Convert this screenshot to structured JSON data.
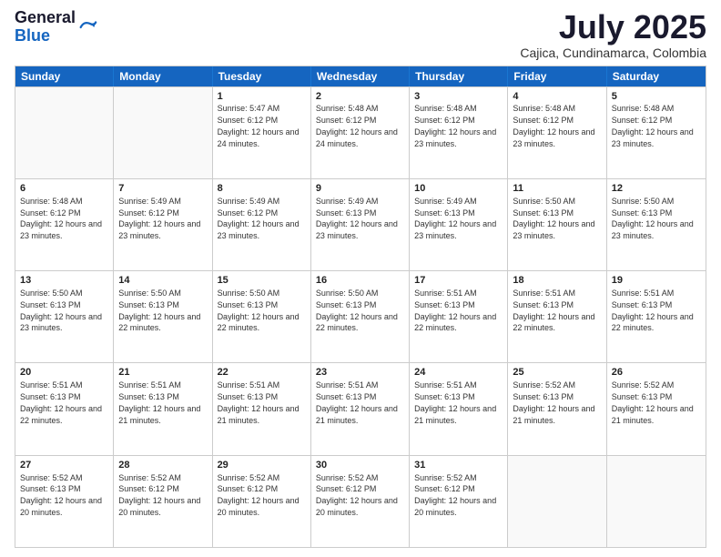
{
  "logo": {
    "general": "General",
    "blue": "Blue"
  },
  "header": {
    "month": "July 2025",
    "location": "Cajica, Cundinamarca, Colombia"
  },
  "days": [
    "Sunday",
    "Monday",
    "Tuesday",
    "Wednesday",
    "Thursday",
    "Friday",
    "Saturday"
  ],
  "weeks": [
    [
      {
        "day": "",
        "sunrise": "",
        "sunset": "",
        "daylight": ""
      },
      {
        "day": "",
        "sunrise": "",
        "sunset": "",
        "daylight": ""
      },
      {
        "day": "1",
        "sunrise": "Sunrise: 5:47 AM",
        "sunset": "Sunset: 6:12 PM",
        "daylight": "Daylight: 12 hours and 24 minutes."
      },
      {
        "day": "2",
        "sunrise": "Sunrise: 5:48 AM",
        "sunset": "Sunset: 6:12 PM",
        "daylight": "Daylight: 12 hours and 24 minutes."
      },
      {
        "day": "3",
        "sunrise": "Sunrise: 5:48 AM",
        "sunset": "Sunset: 6:12 PM",
        "daylight": "Daylight: 12 hours and 23 minutes."
      },
      {
        "day": "4",
        "sunrise": "Sunrise: 5:48 AM",
        "sunset": "Sunset: 6:12 PM",
        "daylight": "Daylight: 12 hours and 23 minutes."
      },
      {
        "day": "5",
        "sunrise": "Sunrise: 5:48 AM",
        "sunset": "Sunset: 6:12 PM",
        "daylight": "Daylight: 12 hours and 23 minutes."
      }
    ],
    [
      {
        "day": "6",
        "sunrise": "Sunrise: 5:48 AM",
        "sunset": "Sunset: 6:12 PM",
        "daylight": "Daylight: 12 hours and 23 minutes."
      },
      {
        "day": "7",
        "sunrise": "Sunrise: 5:49 AM",
        "sunset": "Sunset: 6:12 PM",
        "daylight": "Daylight: 12 hours and 23 minutes."
      },
      {
        "day": "8",
        "sunrise": "Sunrise: 5:49 AM",
        "sunset": "Sunset: 6:12 PM",
        "daylight": "Daylight: 12 hours and 23 minutes."
      },
      {
        "day": "9",
        "sunrise": "Sunrise: 5:49 AM",
        "sunset": "Sunset: 6:13 PM",
        "daylight": "Daylight: 12 hours and 23 minutes."
      },
      {
        "day": "10",
        "sunrise": "Sunrise: 5:49 AM",
        "sunset": "Sunset: 6:13 PM",
        "daylight": "Daylight: 12 hours and 23 minutes."
      },
      {
        "day": "11",
        "sunrise": "Sunrise: 5:50 AM",
        "sunset": "Sunset: 6:13 PM",
        "daylight": "Daylight: 12 hours and 23 minutes."
      },
      {
        "day": "12",
        "sunrise": "Sunrise: 5:50 AM",
        "sunset": "Sunset: 6:13 PM",
        "daylight": "Daylight: 12 hours and 23 minutes."
      }
    ],
    [
      {
        "day": "13",
        "sunrise": "Sunrise: 5:50 AM",
        "sunset": "Sunset: 6:13 PM",
        "daylight": "Daylight: 12 hours and 23 minutes."
      },
      {
        "day": "14",
        "sunrise": "Sunrise: 5:50 AM",
        "sunset": "Sunset: 6:13 PM",
        "daylight": "Daylight: 12 hours and 22 minutes."
      },
      {
        "day": "15",
        "sunrise": "Sunrise: 5:50 AM",
        "sunset": "Sunset: 6:13 PM",
        "daylight": "Daylight: 12 hours and 22 minutes."
      },
      {
        "day": "16",
        "sunrise": "Sunrise: 5:50 AM",
        "sunset": "Sunset: 6:13 PM",
        "daylight": "Daylight: 12 hours and 22 minutes."
      },
      {
        "day": "17",
        "sunrise": "Sunrise: 5:51 AM",
        "sunset": "Sunset: 6:13 PM",
        "daylight": "Daylight: 12 hours and 22 minutes."
      },
      {
        "day": "18",
        "sunrise": "Sunrise: 5:51 AM",
        "sunset": "Sunset: 6:13 PM",
        "daylight": "Daylight: 12 hours and 22 minutes."
      },
      {
        "day": "19",
        "sunrise": "Sunrise: 5:51 AM",
        "sunset": "Sunset: 6:13 PM",
        "daylight": "Daylight: 12 hours and 22 minutes."
      }
    ],
    [
      {
        "day": "20",
        "sunrise": "Sunrise: 5:51 AM",
        "sunset": "Sunset: 6:13 PM",
        "daylight": "Daylight: 12 hours and 22 minutes."
      },
      {
        "day": "21",
        "sunrise": "Sunrise: 5:51 AM",
        "sunset": "Sunset: 6:13 PM",
        "daylight": "Daylight: 12 hours and 21 minutes."
      },
      {
        "day": "22",
        "sunrise": "Sunrise: 5:51 AM",
        "sunset": "Sunset: 6:13 PM",
        "daylight": "Daylight: 12 hours and 21 minutes."
      },
      {
        "day": "23",
        "sunrise": "Sunrise: 5:51 AM",
        "sunset": "Sunset: 6:13 PM",
        "daylight": "Daylight: 12 hours and 21 minutes."
      },
      {
        "day": "24",
        "sunrise": "Sunrise: 5:51 AM",
        "sunset": "Sunset: 6:13 PM",
        "daylight": "Daylight: 12 hours and 21 minutes."
      },
      {
        "day": "25",
        "sunrise": "Sunrise: 5:52 AM",
        "sunset": "Sunset: 6:13 PM",
        "daylight": "Daylight: 12 hours and 21 minutes."
      },
      {
        "day": "26",
        "sunrise": "Sunrise: 5:52 AM",
        "sunset": "Sunset: 6:13 PM",
        "daylight": "Daylight: 12 hours and 21 minutes."
      }
    ],
    [
      {
        "day": "27",
        "sunrise": "Sunrise: 5:52 AM",
        "sunset": "Sunset: 6:13 PM",
        "daylight": "Daylight: 12 hours and 20 minutes."
      },
      {
        "day": "28",
        "sunrise": "Sunrise: 5:52 AM",
        "sunset": "Sunset: 6:12 PM",
        "daylight": "Daylight: 12 hours and 20 minutes."
      },
      {
        "day": "29",
        "sunrise": "Sunrise: 5:52 AM",
        "sunset": "Sunset: 6:12 PM",
        "daylight": "Daylight: 12 hours and 20 minutes."
      },
      {
        "day": "30",
        "sunrise": "Sunrise: 5:52 AM",
        "sunset": "Sunset: 6:12 PM",
        "daylight": "Daylight: 12 hours and 20 minutes."
      },
      {
        "day": "31",
        "sunrise": "Sunrise: 5:52 AM",
        "sunset": "Sunset: 6:12 PM",
        "daylight": "Daylight: 12 hours and 20 minutes."
      },
      {
        "day": "",
        "sunrise": "",
        "sunset": "",
        "daylight": ""
      },
      {
        "day": "",
        "sunrise": "",
        "sunset": "",
        "daylight": ""
      }
    ]
  ]
}
